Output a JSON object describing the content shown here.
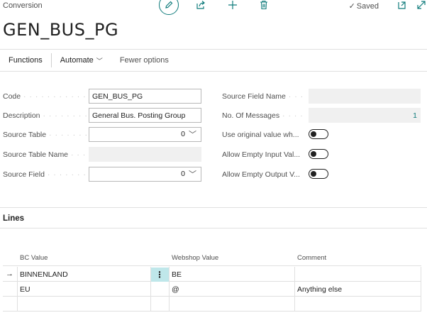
{
  "header": {
    "breadcrumb": "Conversion",
    "saved_label": "Saved",
    "title": "GEN_BUS_PG",
    "icons": [
      "edit-icon",
      "share-icon",
      "add-icon",
      "delete-icon",
      "open-new-window-icon",
      "expand-icon"
    ]
  },
  "actions": {
    "functions": "Functions",
    "automate": "Automate",
    "fewer_options": "Fewer options"
  },
  "fields_left": {
    "code_label": "Code",
    "code_value": "GEN_BUS_PG",
    "description_label": "Description",
    "description_value": "General Bus. Posting Group",
    "source_table_label": "Source Table",
    "source_table_value": "0",
    "source_table_name_label": "Source Table Name",
    "source_table_name_value": "",
    "source_field_label": "Source Field",
    "source_field_value": "0"
  },
  "fields_right": {
    "source_field_name_label": "Source Field Name",
    "source_field_name_value": "",
    "no_of_messages_label": "No. Of Messages",
    "no_of_messages_value": "1",
    "use_original_label": "Use original value wh...",
    "use_original_value": false,
    "allow_empty_input_label": "Allow Empty Input Val...",
    "allow_empty_input_value": false,
    "allow_empty_output_label": "Allow Empty Output V...",
    "allow_empty_output_value": false
  },
  "lines": {
    "title": "Lines",
    "columns": {
      "bc_value": "BC Value",
      "webshop_value": "Webshop Value",
      "comment": "Comment"
    },
    "rows": [
      {
        "bc_value": "BINNENLAND",
        "webshop_value": "BE",
        "comment": ""
      },
      {
        "bc_value": "EU",
        "webshop_value": "@",
        "comment": "Anything else"
      },
      {
        "bc_value": "",
        "webshop_value": "",
        "comment": ""
      }
    ],
    "row_arrow": "→",
    "row_menu": "⋮"
  },
  "colors": {
    "accent": "#0f7b7b",
    "selected_cell": "#bfe7ea"
  }
}
